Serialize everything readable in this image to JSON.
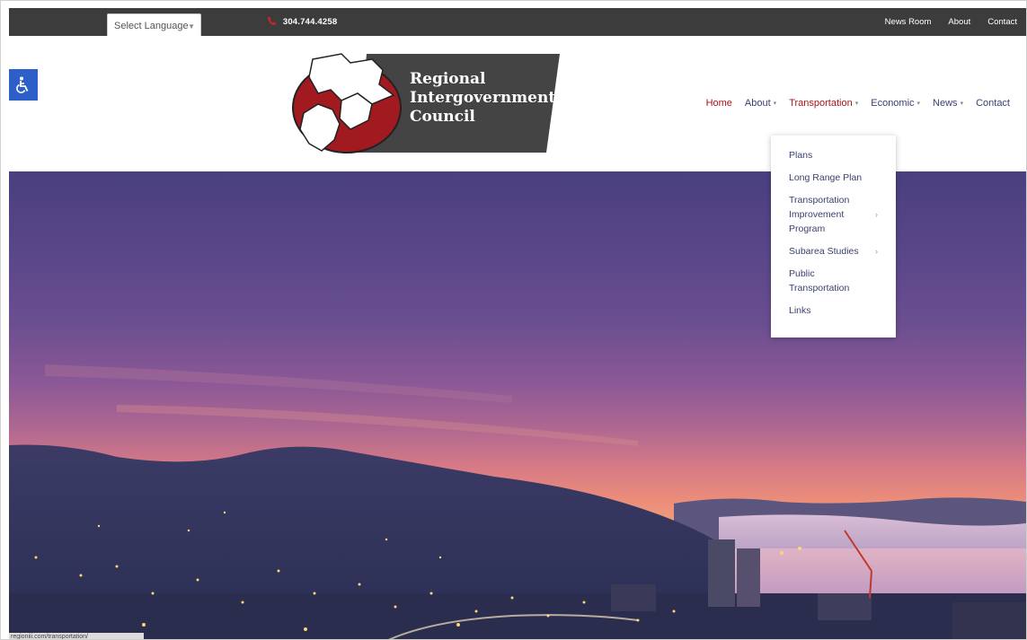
{
  "topbar": {
    "language_select": "Select Language",
    "phone": "304.744.4258",
    "links": [
      "News Room",
      "About",
      "Contact"
    ]
  },
  "logo": {
    "line1": "Regional",
    "line2": "Intergovernmental",
    "line3": "Council"
  },
  "nav": {
    "home": "Home",
    "about": "About",
    "transportation": "Transportation",
    "economic": "Economic",
    "news": "News",
    "contact": "Contact"
  },
  "dropdown": {
    "items": [
      {
        "label": "Plans",
        "has_submenu": false
      },
      {
        "label": "Long Range Plan",
        "has_submenu": false
      },
      {
        "label": "Transportation Improvement Program",
        "has_submenu": true
      },
      {
        "label": "Subarea Studies",
        "has_submenu": true
      },
      {
        "label": "Public Transportation",
        "has_submenu": false
      },
      {
        "label": "Links",
        "has_submenu": false
      }
    ]
  },
  "status_url": "regioniii.com/transportation/",
  "colors": {
    "topbar": "#3c3c3c",
    "nav_active": "#a8161b",
    "nav_text": "#3a3f6e",
    "accessibility": "#2d5fc8"
  },
  "icons": {
    "phone": "phone-icon",
    "accessibility": "wheelchair-icon",
    "chevron": "chevron-down-icon",
    "submenu_arrow": "chevron-right-icon"
  }
}
